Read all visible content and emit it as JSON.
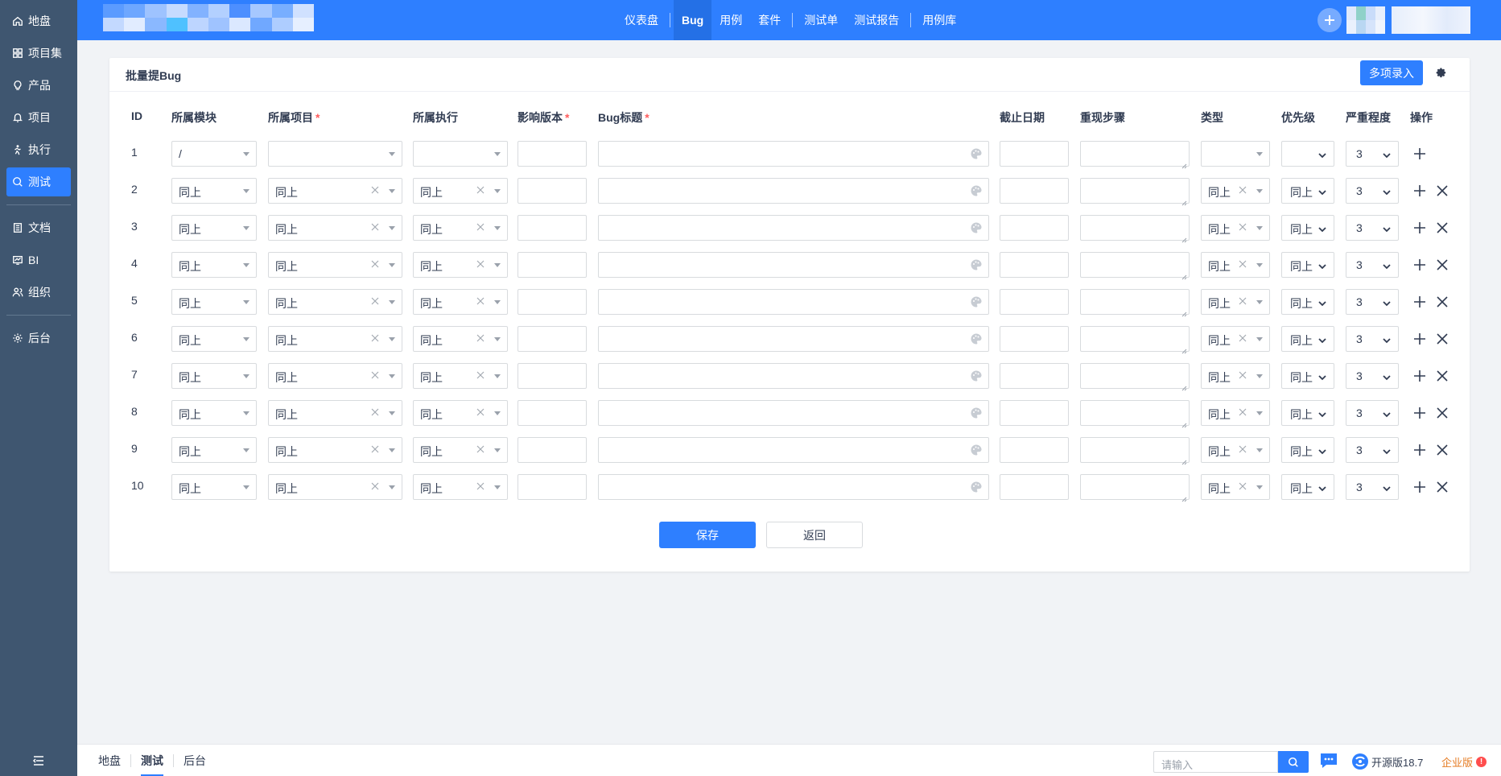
{
  "sidebar": {
    "items": [
      {
        "label": "地盘",
        "icon": "home-icon",
        "active": false
      },
      {
        "label": "项目集",
        "icon": "grid-icon",
        "active": false
      },
      {
        "label": "产品",
        "icon": "lightbulb-icon",
        "active": false
      },
      {
        "label": "项目",
        "icon": "bell-icon",
        "active": false
      },
      {
        "label": "执行",
        "icon": "run-icon",
        "active": false
      },
      {
        "label": "测试",
        "icon": "magnifier-icon",
        "active": true
      },
      {
        "label": "文档",
        "icon": "doc-icon",
        "active": false
      },
      {
        "label": "BI",
        "icon": "chart-monitor-icon",
        "active": false
      },
      {
        "label": "组织",
        "icon": "people-icon",
        "active": false
      },
      {
        "label": "后台",
        "icon": "gear-icon",
        "active": false
      }
    ]
  },
  "topnav": {
    "items": [
      {
        "label": "仪表盘"
      },
      {
        "label": "Bug",
        "active": true
      },
      {
        "label": "用例"
      },
      {
        "label": "套件"
      },
      {
        "label": "测试单"
      },
      {
        "label": "测试报告"
      },
      {
        "label": "用例库"
      }
    ]
  },
  "panel": {
    "title": "批量提Bug",
    "multi_button": "多项录入"
  },
  "columns": {
    "id": "ID",
    "module": "所属模块",
    "project": "所属项目",
    "execution": "所属执行",
    "build": "影响版本",
    "title": "Bug标题",
    "deadline": "截止日期",
    "steps": "重现步骤",
    "type": "类型",
    "pri": "优先级",
    "severity": "严重程度",
    "actions": "操作",
    "required_mark": "*"
  },
  "rows": [
    {
      "id": "1",
      "module": "/",
      "project": "",
      "execution": "",
      "type": "",
      "pri": "",
      "severity": "3"
    },
    {
      "id": "2",
      "module": "同上",
      "project": "同上",
      "execution": "同上",
      "type": "同上",
      "pri": "同上",
      "severity": "3"
    },
    {
      "id": "3",
      "module": "同上",
      "project": "同上",
      "execution": "同上",
      "type": "同上",
      "pri": "同上",
      "severity": "3"
    },
    {
      "id": "4",
      "module": "同上",
      "project": "同上",
      "execution": "同上",
      "type": "同上",
      "pri": "同上",
      "severity": "3"
    },
    {
      "id": "5",
      "module": "同上",
      "project": "同上",
      "execution": "同上",
      "type": "同上",
      "pri": "同上",
      "severity": "3"
    },
    {
      "id": "6",
      "module": "同上",
      "project": "同上",
      "execution": "同上",
      "type": "同上",
      "pri": "同上",
      "severity": "3"
    },
    {
      "id": "7",
      "module": "同上",
      "project": "同上",
      "execution": "同上",
      "type": "同上",
      "pri": "同上",
      "severity": "3"
    },
    {
      "id": "8",
      "module": "同上",
      "project": "同上",
      "execution": "同上",
      "type": "同上",
      "pri": "同上",
      "severity": "3"
    },
    {
      "id": "9",
      "module": "同上",
      "project": "同上",
      "execution": "同上",
      "type": "同上",
      "pri": "同上",
      "severity": "3"
    },
    {
      "id": "10",
      "module": "同上",
      "project": "同上",
      "execution": "同上",
      "type": "同上",
      "pri": "同上",
      "severity": "3"
    }
  ],
  "form": {
    "save": "保存",
    "back": "返回"
  },
  "footer": {
    "crumbs": [
      {
        "label": "地盘"
      },
      {
        "label": "测试",
        "active": true
      },
      {
        "label": "后台"
      }
    ],
    "search_placeholder": "请输入",
    "version": "开源版18.7",
    "enterprise": "企业版",
    "enterprise_badge": "!"
  },
  "colors": {
    "primary": "#2e7fff",
    "sidebar": "#3f5670",
    "danger": "#ff5d5d"
  }
}
